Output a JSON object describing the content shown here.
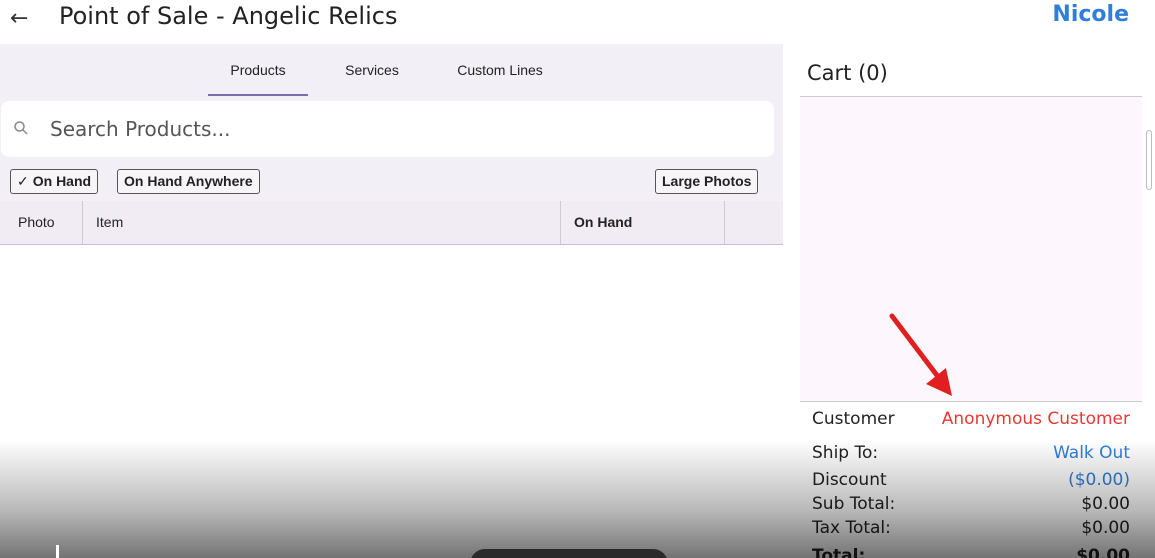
{
  "header": {
    "title": "Point of Sale - Angelic Relics",
    "user": "Nicole",
    "back_icon": "arrow-left-icon"
  },
  "tabs": [
    {
      "label": "Products",
      "active": true
    },
    {
      "label": "Services",
      "active": false
    },
    {
      "label": "Custom Lines",
      "active": false
    }
  ],
  "search": {
    "placeholder": "Search Products...",
    "value": ""
  },
  "filters": {
    "on_hand": "On Hand",
    "on_hand_checked": true,
    "on_hand_anywhere": "On Hand Anywhere",
    "large_photos": "Large Photos"
  },
  "table": {
    "columns": [
      "Photo",
      "Item",
      "On Hand"
    ],
    "rows": []
  },
  "cart": {
    "title": "Cart (0)",
    "customer_label": "Customer",
    "customer_value": "Anonymous Customer",
    "ship_label": "Ship To:",
    "ship_value": "Walk Out",
    "discount_label": "Discount",
    "discount_value": "($0.00)",
    "subtotal_label": "Sub Total:",
    "subtotal_value": "$0.00",
    "tax_label": "Tax Total:",
    "tax_value": "$0.00",
    "total_label": "Total:",
    "total_value": "$0.00"
  },
  "colors": {
    "accent": "#2f7fd8",
    "customer_red": "#e53935",
    "annotation_arrow": "#e02020",
    "tab_underline": "#7b6bb0"
  }
}
